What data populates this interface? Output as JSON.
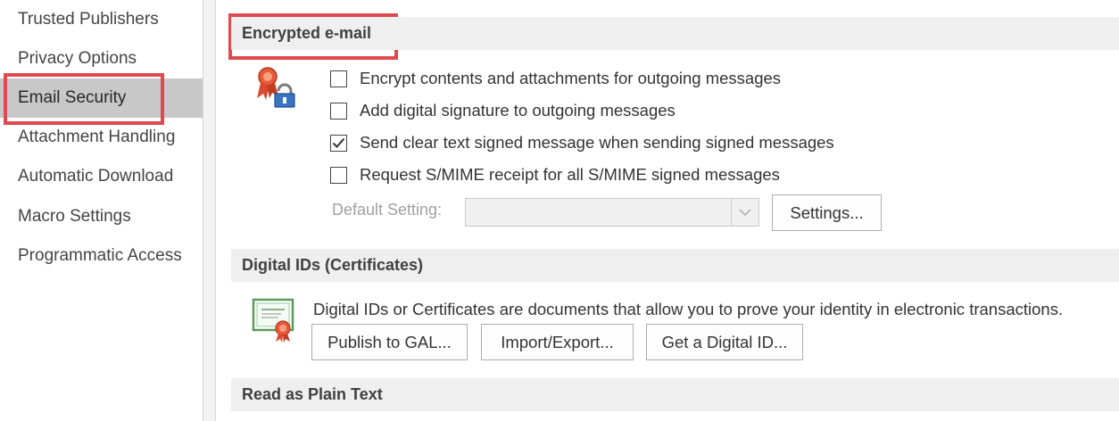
{
  "sidebar": {
    "items": [
      {
        "label": "Trusted Publishers"
      },
      {
        "label": "Privacy Options"
      },
      {
        "label": "Email Security",
        "selected": true
      },
      {
        "label": "Attachment Handling"
      },
      {
        "label": "Automatic Download"
      },
      {
        "label": "Macro Settings"
      },
      {
        "label": "Programmatic Access"
      }
    ]
  },
  "encrypted_email": {
    "header": "Encrypted e-mail",
    "icon": "certificate-lock-icon",
    "options": [
      {
        "label": "Encrypt contents and attachments for outgoing messages",
        "checked": false
      },
      {
        "label": "Add digital signature to outgoing messages",
        "checked": false
      },
      {
        "label": "Send clear text signed message when sending signed messages",
        "checked": true
      },
      {
        "label": "Request S/MIME receipt for all S/MIME signed messages",
        "checked": false
      }
    ],
    "default_setting_label": "Default Setting:",
    "default_setting_value": "",
    "settings_button": "Settings..."
  },
  "digital_ids": {
    "header": "Digital IDs (Certificates)",
    "icon": "certificate-icon",
    "description": "Digital IDs or Certificates are documents that allow you to prove your identity in electronic transactions.",
    "buttons": {
      "publish": "Publish to GAL...",
      "import_export": "Import/Export...",
      "get_id": "Get a Digital ID..."
    }
  },
  "read_plain_text": {
    "header": "Read as Plain Text"
  },
  "colors": {
    "highlight": "#e04a4f",
    "selected_nav": "#c8c8c8",
    "section_header_bg": "#efefef"
  }
}
